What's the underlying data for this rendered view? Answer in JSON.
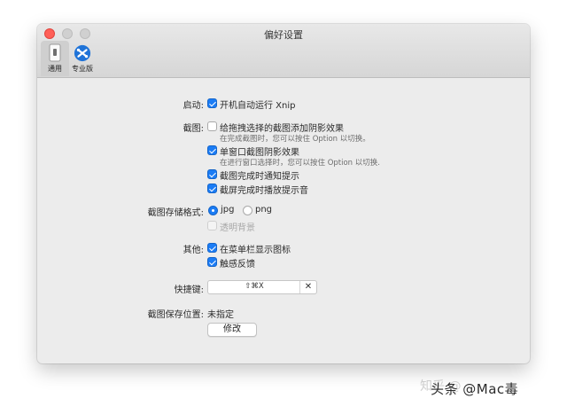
{
  "window": {
    "title": "偏好设置",
    "tabs": [
      {
        "label": "通用",
        "icon": "switch-icon"
      },
      {
        "label": "专业版",
        "icon": "xnip-pro-icon"
      }
    ]
  },
  "settings": {
    "startup": {
      "label": "启动:",
      "options": [
        {
          "label": "开机自动运行 Xnip",
          "checked": true
        }
      ]
    },
    "screenshot": {
      "label": "截图:",
      "options": [
        {
          "label": "给拖拽选择的截图添加阴影效果",
          "checked": false,
          "hint": "在完成截图时，您可以按住 Option 以切换。"
        },
        {
          "label": "单窗口截图阴影效果",
          "checked": true,
          "hint": "在进行窗口选择时，您可以按住 Option 以切换."
        },
        {
          "label": "截图完成时通知提示",
          "checked": true
        },
        {
          "label": "截屏完成时播放提示音",
          "checked": true
        }
      ]
    },
    "format": {
      "label": "截图存储格式:",
      "jpg": "jpg",
      "png": "png",
      "selected": "jpg",
      "transparent_label": "透明背景",
      "transparent_enabled": false
    },
    "other": {
      "label": "其他:",
      "options": [
        {
          "label": "在菜单栏显示图标",
          "checked": true
        },
        {
          "label": "触感反馈",
          "checked": true
        }
      ]
    },
    "shortcut": {
      "label": "快捷键:",
      "value": "⇧⌘X",
      "clear": "✕"
    },
    "save_location": {
      "label": "截图保存位置:",
      "value": "未指定",
      "button": "修改"
    }
  },
  "watermark": {
    "text": "头条 @Mac毒",
    "ghost": "知乎 @"
  },
  "colors": {
    "accent": "#1b7cf5",
    "close": "#ff5f57"
  }
}
